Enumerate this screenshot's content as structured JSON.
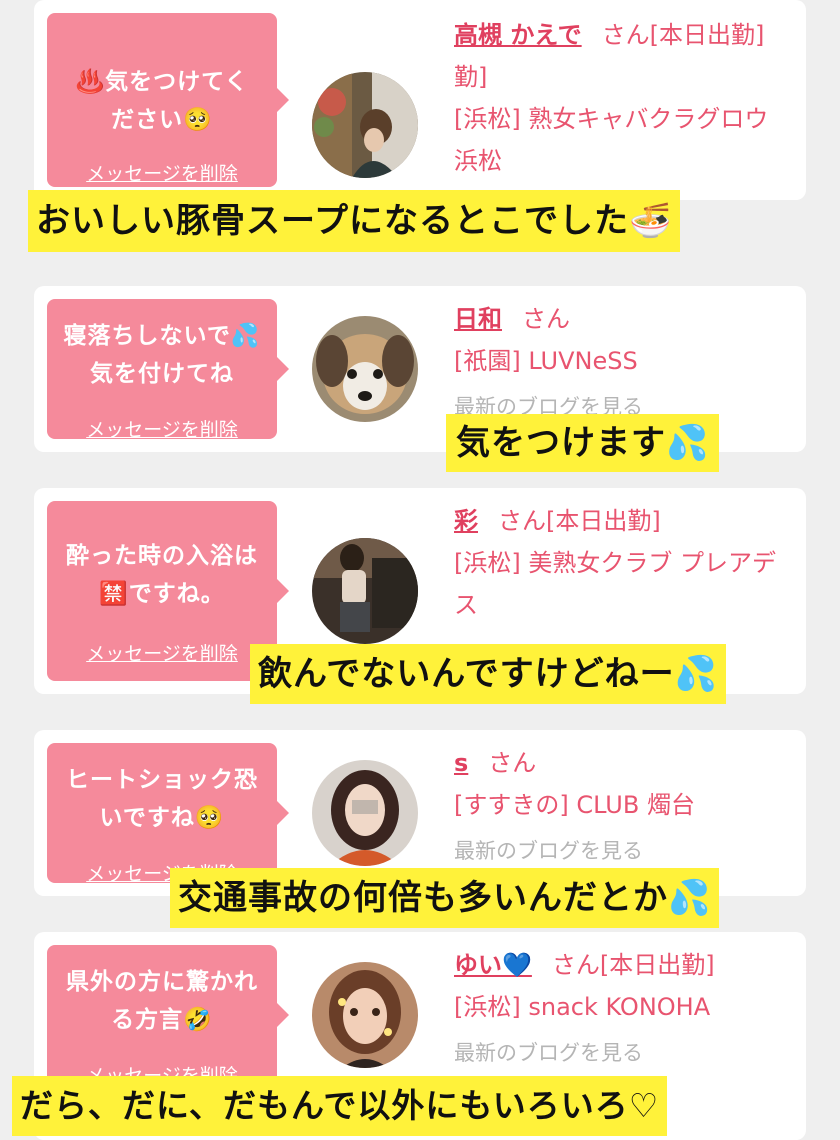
{
  "cards": [
    {
      "message": "♨️気をつけてください🥺",
      "delete_label": "メッセージを削除",
      "name": "高槻 かえで",
      "suffix": "さん[本日出勤]",
      "shop": "[浜松] 熟女キャバクラグロウ 浜松",
      "blog": ""
    },
    {
      "message": "寝落ちしないで💦気を付けてね",
      "delete_label": "メッセージを削除",
      "name": "日和",
      "suffix": "さん",
      "shop": "[祇園] LUVNeSS",
      "blog": "最新のブログを見る"
    },
    {
      "message": "酔った時の入浴は🈲ですね。",
      "delete_label": "メッセージを削除",
      "name": "彩",
      "suffix": "さん[本日出勤]",
      "shop": "[浜松] 美熟女クラブ プレアデス",
      "blog": ""
    },
    {
      "message": "ヒートショック恐いですね🥺",
      "delete_label": "メッセージを削除",
      "name": "s",
      "suffix": "さん",
      "shop": "[すすきの] CLUB 燭台",
      "blog": "最新のブログを見る"
    },
    {
      "message": "県外の方に驚かれる方言🤣",
      "delete_label": "メッセージを削除",
      "name": "ゆい💙",
      "suffix": "さん[本日出勤]",
      "shop": "[浜松] snack KONOHA",
      "blog": "最新のブログを見る"
    }
  ],
  "captions": [
    "おいしい豚骨スープになるとこでした🍜",
    "気をつけます💦",
    "飲んでないんですけどねー💦",
    "交通事故の何倍も多いんだとか💦",
    "だら、だに、だもんで以外にもいろいろ♡"
  ],
  "colors": {
    "bubble": "#f58a9b",
    "link": "#e8546f",
    "caption_bg": "#fff23a"
  }
}
